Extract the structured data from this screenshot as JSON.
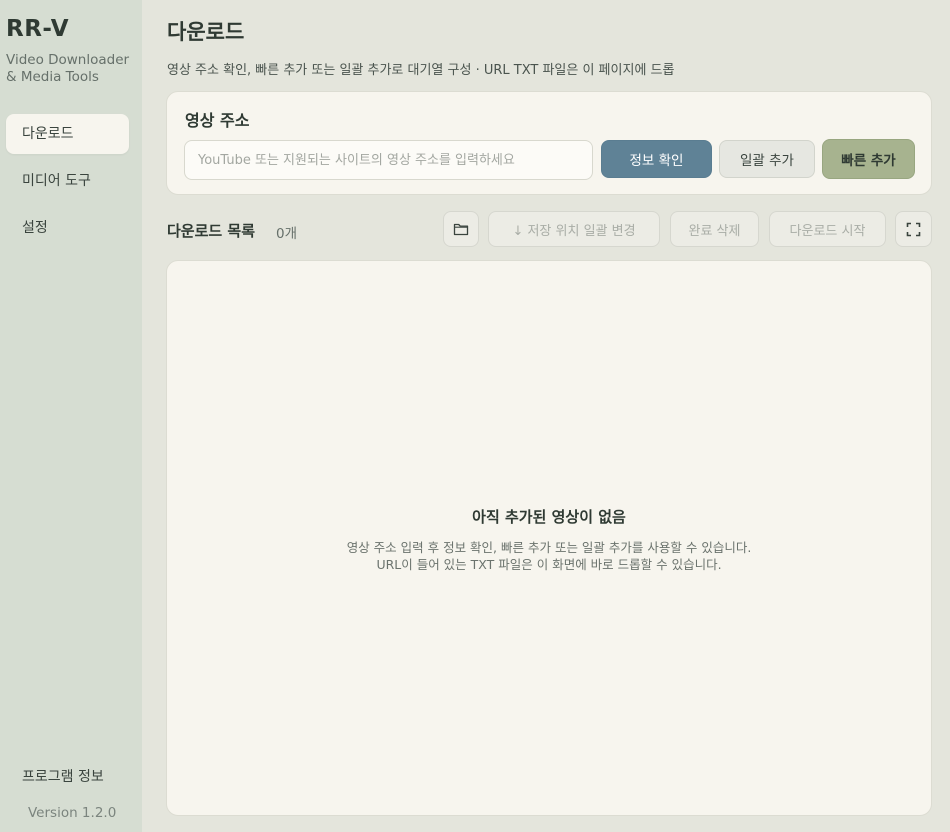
{
  "sidebar": {
    "app_name": "RR-V",
    "app_subtitle": "Video Downloader & Media Tools",
    "nav": [
      {
        "label": "다운로드",
        "active": true
      },
      {
        "label": "미디어 도구",
        "active": false
      },
      {
        "label": "설정",
        "active": false
      }
    ],
    "about_label": "프로그램 정보",
    "version": "Version 1.2.0"
  },
  "header": {
    "title": "다운로드",
    "description": "영상 주소 확인, 빠른 추가 또는 일괄 추가로 대기열 구성 · URL TXT 파일은 이 페이지에 드롭"
  },
  "url_card": {
    "title": "영상 주소",
    "input_value": "",
    "input_placeholder": "YouTube 또는 지원되는 사이트의 영상 주소를 입력하세요",
    "info_button": "정보 확인",
    "batch_button": "일괄 추가",
    "quick_button": "빠른 추가"
  },
  "list": {
    "title": "다운로드 목록",
    "count": "0개",
    "folder_icon": "folder-icon",
    "save_location_label": "↓ 저장 위치 일괄 변경",
    "clear_done_label": "완료 삭제",
    "start_label": "다운로드 시작",
    "expand_icon": "expand-icon",
    "empty_title": "아직 추가된 영상이 없음",
    "empty_line1": "영상 주소 입력 후 정보 확인, 빠른 추가 또는 일괄 추가를 사용할 수 있습니다.",
    "empty_line2": "URL이 들어 있는 TXT 파일은 이 화면에 바로 드롭할 수 있습니다."
  },
  "colors": {
    "sidebar_bg": "#d6ddd2",
    "main_bg": "#e4e5dc",
    "card_bg": "#f7f5ee",
    "primary": "#5f8296",
    "accent": "#a7b38f"
  }
}
